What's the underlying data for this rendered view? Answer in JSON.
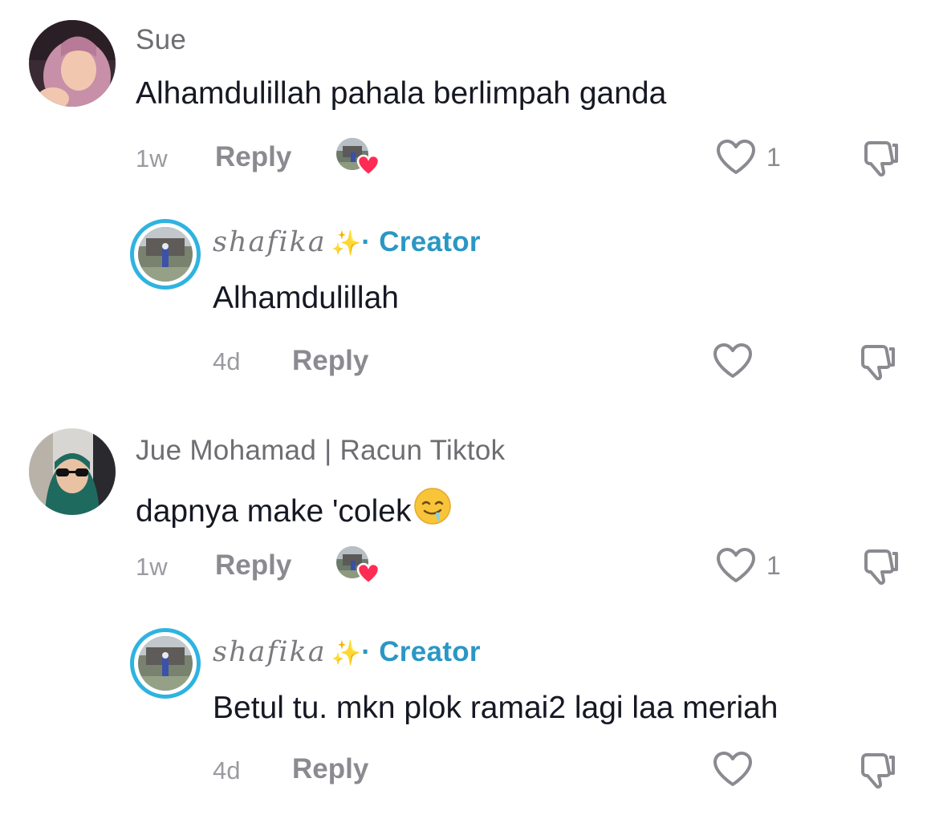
{
  "comments": [
    {
      "username": "Sue",
      "text": "Alhamdulillah pahala berlimpah ganda",
      "time": "1w",
      "reply_label": "Reply",
      "like_count": "1",
      "creator_liked": true
    },
    {
      "username": "shafika",
      "badge": "· Creator",
      "text": "Alhamdulillah",
      "time": "4d",
      "reply_label": "Reply",
      "like_count": "",
      "is_creator": true
    },
    {
      "username": "Jue Mohamad | Racun Tiktok",
      "text": "dapnya make 'colek",
      "time": "1w",
      "reply_label": "Reply",
      "like_count": "1",
      "creator_liked": true
    },
    {
      "username": "shafika",
      "badge": "· Creator",
      "text": "Betul tu. mkn plok ramai2 lagi laa meriah",
      "time": "4d",
      "reply_label": "Reply",
      "like_count": "",
      "is_creator": true
    }
  ],
  "icons": {
    "like": "heart-outline-icon",
    "dislike": "thumbs-down-icon",
    "sparkle": "sparkles-icon",
    "liked_by_creator": "heart-filled-icon",
    "emoji": "drooling-face-emoji"
  },
  "colors": {
    "creator_tag": "#2a97c4",
    "creator_ring": "#2fb3e0",
    "heart_badge": "#fe2c55",
    "text": "#161823",
    "secondary": "#8a8a90"
  }
}
